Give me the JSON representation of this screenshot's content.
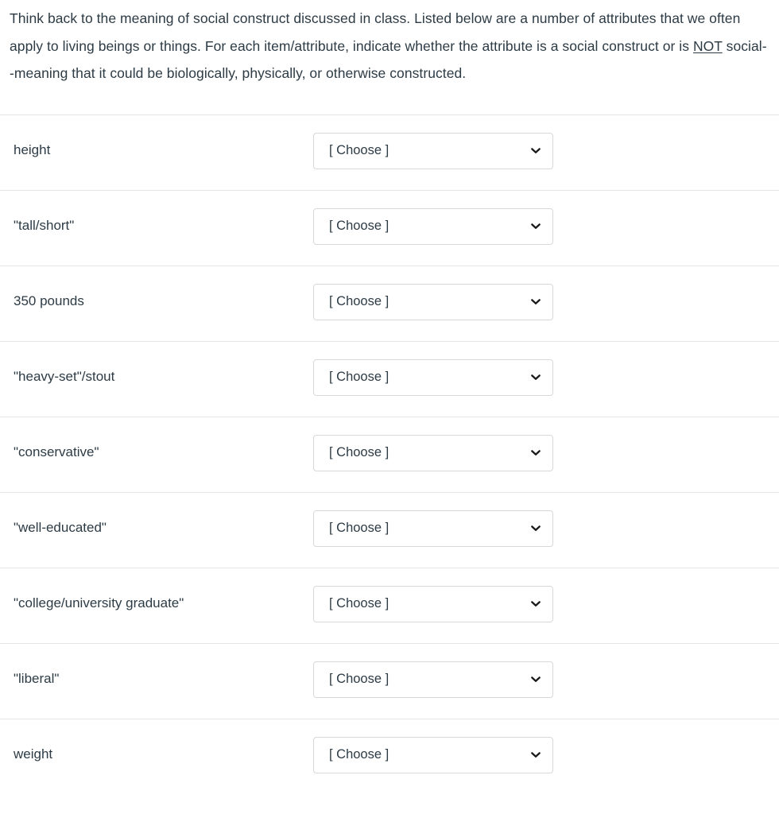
{
  "question": {
    "text_parts": {
      "before_not": "Think back to the meaning of social construct discussed in class. Listed below are a number of attributes that we often apply to living beings or things. For each item/attribute, indicate whether the attribute is a social construct or is ",
      "not_word": "NOT",
      "after_not": " social--meaning that it could be biologically, physically, or otherwise constructed."
    }
  },
  "select_placeholder": "[ Choose ]",
  "dropdown_icon": "chevron-down-icon",
  "colors": {
    "text": "#2d3b45",
    "divider": "#e4e6e9",
    "select_border": "#d8d8d8",
    "background": "#ffffff"
  },
  "answers": [
    {
      "label": "height",
      "value": "[ Choose ]"
    },
    {
      "label": "\"tall/short\"",
      "value": "[ Choose ]"
    },
    {
      "label": "350 pounds",
      "value": "[ Choose ]"
    },
    {
      "label": "\"heavy-set\"/stout",
      "value": "[ Choose ]"
    },
    {
      "label": "\"conservative\"",
      "value": "[ Choose ]"
    },
    {
      "label": "\"well-educated\"",
      "value": "[ Choose ]"
    },
    {
      "label": "\"college/university graduate\"",
      "value": "[ Choose ]"
    },
    {
      "label": "\"liberal\"",
      "value": "[ Choose ]"
    },
    {
      "label": "weight",
      "value": "[ Choose ]"
    }
  ]
}
